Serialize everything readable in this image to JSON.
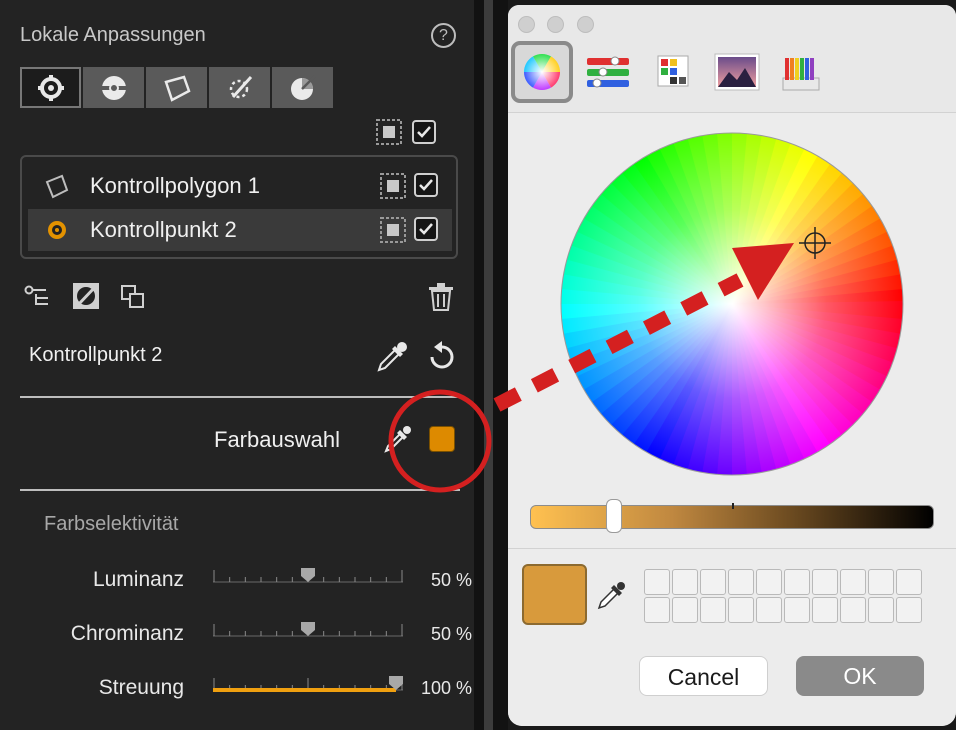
{
  "left_panel": {
    "title": "Lokale Anpassungen",
    "help_glyph": "?",
    "tools": [
      "control-point-tool",
      "gradient-tool",
      "polygon-tool",
      "brush-tool",
      "color-range-tool"
    ],
    "controls": [
      {
        "label": "Kontrollpolygon 1",
        "icon": "polygon-icon",
        "selected": false
      },
      {
        "label": "Kontrollpunkt 2",
        "icon": "control-point-icon",
        "selected": true
      }
    ],
    "selected_name": "Kontrollpunkt 2",
    "color_pick_label": "Farbauswahl",
    "swatch_color": "#dd8a00",
    "section_title": "Farbselektivität",
    "sliders": [
      {
        "label": "Luminanz",
        "value": "50 %",
        "fraction": 0.5
      },
      {
        "label": "Chrominanz",
        "value": "50 %",
        "fraction": 0.5
      },
      {
        "label": "Streuung",
        "value": "100 %",
        "fraction": 1.0
      }
    ],
    "accent_color": "#f0a010"
  },
  "color_dialog": {
    "tabs": [
      "color-wheel",
      "color-sliders",
      "color-palettes",
      "image-palettes",
      "pencils"
    ],
    "current_color": "#d89a3c",
    "buttons": {
      "cancel": "Cancel",
      "ok": "OK"
    }
  },
  "annotation": {
    "color": "#d42020"
  }
}
